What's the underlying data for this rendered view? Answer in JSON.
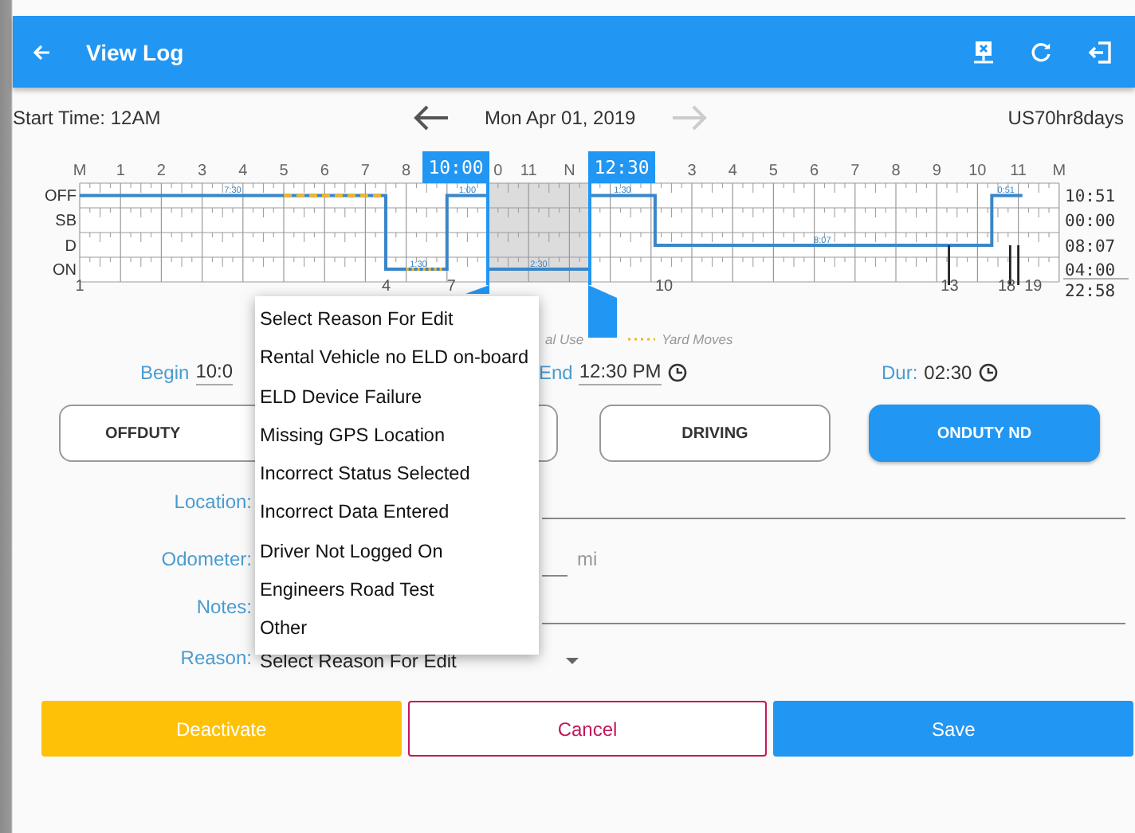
{
  "app_bar": {
    "title": "View Log"
  },
  "date_bar": {
    "start_time": "Start Time: 12AM",
    "date": "Mon Apr 01, 2019",
    "ruleset": "US70hr8days"
  },
  "graph": {
    "hour_labels": [
      "M",
      "1",
      "2",
      "3",
      "4",
      "5",
      "6",
      "7",
      "8",
      "0",
      "11",
      "N",
      "3",
      "4",
      "5",
      "6",
      "7",
      "8",
      "9",
      "10",
      "11",
      "M"
    ],
    "row_labels": [
      "OFF",
      "SB",
      "D",
      "ON"
    ],
    "totals": [
      "10:51",
      "00:00",
      "08:07",
      "04:00"
    ],
    "total": "22:58",
    "selected_start": "10:00",
    "selected_end": "12:30",
    "segment_labels": [
      "7:30",
      "1:30",
      "1:00",
      "2:30",
      "1:30",
      "8:07",
      "0:51"
    ],
    "event_numbers": [
      "1",
      "4",
      "7",
      "10",
      "13",
      "18",
      "19"
    ],
    "legend": [
      "al Use",
      "Yard Moves"
    ]
  },
  "times": {
    "begin_label": "Begin",
    "begin": "10:0",
    "end_label": "End",
    "end": "12:30 PM",
    "dur_label": "Dur:",
    "dur": "02:30"
  },
  "status_buttons": [
    {
      "label": "OFFDUTY",
      "selected": false
    },
    {
      "label": "DRIVING",
      "selected": false
    },
    {
      "label": "ONDUTY ND",
      "selected": true
    }
  ],
  "form": {
    "location_label": "Location:",
    "odometer_label": "Odometer:",
    "odometer_unit": "mi",
    "notes_label": "Notes:",
    "reason_label": "Reason:",
    "reason_value": "Select Reason For Edit"
  },
  "reason_menu": {
    "options": [
      "Select Reason For Edit",
      "Rental Vehicle no ELD on-board",
      "ELD Device Failure",
      "Missing GPS Location",
      "Incorrect Status Selected",
      "Incorrect Data Entered",
      "Driver Not Logged On",
      "Engineers Road Test",
      "Other"
    ]
  },
  "actions": [
    {
      "label": "Deactivate",
      "kind": "warning"
    },
    {
      "label": "Cancel",
      "kind": "outline"
    },
    {
      "label": "Save",
      "kind": "primary"
    }
  ]
}
